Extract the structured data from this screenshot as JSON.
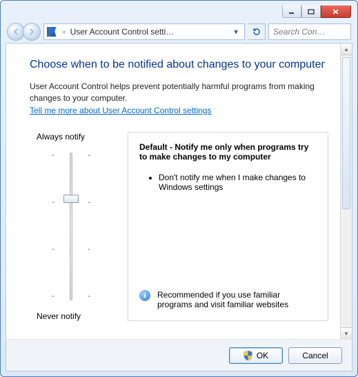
{
  "titlebar": {},
  "toolbar": {
    "path_text": "User Account Control setti…",
    "search_placeholder": "Search Con…"
  },
  "heading": "Choose when to be notified about changes to your computer",
  "intro": "User Account Control helps prevent potentially harmful programs from making changes to your computer.",
  "help_link": "Tell me more about User Account Control settings",
  "slider": {
    "top_label": "Always notify",
    "bottom_label": "Never notify",
    "levels": 4,
    "current_level_from_top": 1
  },
  "panel": {
    "heading": "Default - Notify me only when programs try to make changes to my computer",
    "bullets": [
      "Don't notify me when I make changes to Windows settings"
    ],
    "note": "Recommended if you use familiar programs and visit familiar websites"
  },
  "footer": {
    "ok": "OK",
    "cancel": "Cancel"
  }
}
